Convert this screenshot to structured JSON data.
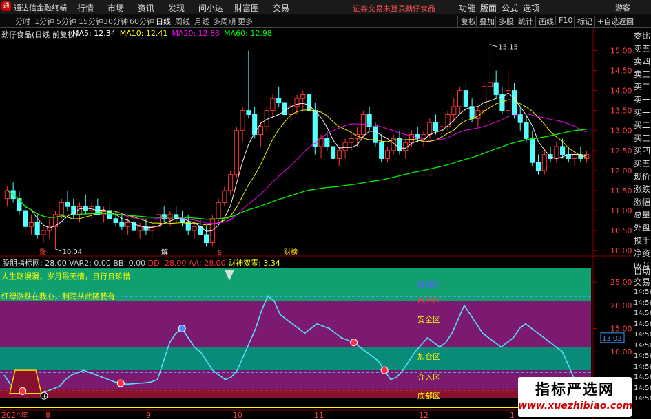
{
  "app": {
    "title": "通达信金融终端",
    "logo": "logo-icon",
    "guest": "游客"
  },
  "menu": [
    "行情",
    "市场",
    "资讯",
    "发现",
    "问小达",
    "财富圈",
    "交易"
  ],
  "notice": "证券交易未登录",
  "notice_stock": "劲仔食品",
  "right_menu": [
    "功能",
    "版面",
    "公式",
    "选项"
  ],
  "toolbar": {
    "periods": [
      "分时",
      "1分钟",
      "5分钟",
      "15分钟",
      "30分钟",
      "60分钟",
      "日线",
      "周线",
      "月线",
      "多周期",
      "更多"
    ],
    "active": "日线",
    "right": [
      "复权",
      "叠加",
      "多股",
      "统计",
      "画线",
      "F10",
      "标记",
      "+自选",
      "返回"
    ]
  },
  "price_panel": {
    "stock": "劲仔食品(日线 前复权)",
    "ma_labels": [
      {
        "text": "MA5: 12.34",
        "color": "#ffffff"
      },
      {
        "text": "MA10: 12.41",
        "color": "#ffff00"
      },
      {
        "text": "MA20: 12.83",
        "color": "#ff00ff"
      },
      {
        "text": "MA60: 12.98",
        "color": "#00ff00"
      }
    ],
    "high_label": "15.15",
    "low_label": "10.04",
    "events": [
      "涨",
      "解",
      "$",
      "财榜"
    ]
  },
  "indicator_panel": {
    "name": "股朋指标网",
    "values": [
      {
        "text": "VAR2: 0.00",
        "color": "#cccccc"
      },
      {
        "text": "BB: 0.00",
        "color": "#cccccc"
      },
      {
        "text": "DD: 28.00",
        "color": "#ff3030"
      },
      {
        "text": "AA: 28.00",
        "color": "#ff3030"
      },
      {
        "text": "财神双零: 3.34",
        "color": "#ffff00"
      }
    ],
    "first_value": ": 28.00",
    "slogan1": "人生路漫漫，岁月最无情，且行且珍惜",
    "slogan2": "红绿涨跌在我心，利润从此随我有",
    "zones": [
      "逃顶区",
      "风险区",
      "安全区",
      "加仓区",
      "介入区",
      "底部区"
    ],
    "current_value": "13.02"
  },
  "right_panel": [
    "委比",
    "卖五",
    "卖四",
    "卖三",
    "卖二",
    "卖一",
    "买一",
    "买二",
    "买三",
    "买四",
    "买五",
    "现价",
    "涨跌",
    "涨幅",
    "总量",
    "外盘",
    "换手",
    "净资",
    "收益"
  ],
  "right_panel2": [
    "自动",
    "交易",
    "14:56",
    "14:56",
    "14:56",
    "14:56",
    "14:56",
    "14:56",
    "14:56",
    "14:56",
    "14:56",
    "14:56",
    "14:56"
  ],
  "watermark": {
    "l1": "指标严选网",
    "l2": "www.xuezhibiao.com"
  },
  "chart_data": [
    {
      "type": "candlestick",
      "title": "劲仔食品(日线 前复权)",
      "y_ticks": [
        15.0,
        14.5,
        14.0,
        13.5,
        13.0,
        12.5,
        12.0,
        11.5,
        11.0,
        10.5,
        10.0
      ],
      "ylim": [
        9.9,
        15.3
      ],
      "x_labels": [
        "2024年",
        "8",
        "9",
        "10",
        "11",
        "12",
        "1"
      ],
      "candles": [
        [
          11.3,
          11.6,
          11.1,
          11.5
        ],
        [
          11.5,
          11.7,
          11.2,
          11.3
        ],
        [
          11.3,
          11.5,
          10.9,
          11.0
        ],
        [
          11.0,
          11.2,
          10.5,
          10.6
        ],
        [
          10.6,
          10.9,
          10.4,
          10.7
        ],
        [
          10.7,
          10.9,
          10.3,
          10.4
        ],
        [
          10.4,
          10.6,
          10.2,
          10.5
        ],
        [
          10.5,
          10.8,
          10.3,
          10.6
        ],
        [
          10.6,
          11.0,
          10.04,
          10.9
        ],
        [
          10.9,
          11.3,
          10.8,
          11.2
        ],
        [
          11.2,
          11.5,
          11.0,
          11.1
        ],
        [
          11.1,
          11.3,
          10.8,
          10.9
        ],
        [
          10.9,
          11.2,
          10.7,
          11.1
        ],
        [
          11.1,
          11.4,
          10.9,
          11.0
        ],
        [
          11.0,
          11.2,
          10.8,
          11.1
        ],
        [
          11.1,
          11.3,
          10.9,
          10.9
        ],
        [
          10.9,
          11.1,
          10.7,
          11.0
        ],
        [
          11.0,
          11.2,
          10.8,
          10.8
        ],
        [
          10.8,
          11.0,
          10.6,
          10.7
        ],
        [
          10.7,
          10.9,
          10.5,
          10.6
        ],
        [
          10.6,
          10.8,
          10.4,
          10.7
        ],
        [
          10.7,
          10.9,
          10.5,
          10.5
        ],
        [
          10.5,
          10.7,
          10.3,
          10.6
        ],
        [
          10.6,
          10.8,
          10.4,
          10.5
        ],
        [
          10.5,
          10.7,
          10.3,
          10.6
        ],
        [
          10.6,
          11.0,
          10.5,
          10.9
        ],
        [
          10.9,
          11.1,
          10.7,
          10.8
        ],
        [
          10.8,
          11.0,
          10.6,
          10.9
        ],
        [
          10.9,
          11.1,
          10.7,
          10.8
        ],
        [
          10.8,
          11.0,
          10.6,
          10.7
        ],
        [
          10.7,
          10.9,
          10.4,
          10.5
        ],
        [
          10.5,
          10.7,
          10.3,
          10.6
        ],
        [
          10.6,
          10.8,
          10.4,
          10.4
        ],
        [
          10.4,
          10.6,
          10.1,
          10.2
        ],
        [
          10.2,
          10.9,
          10.1,
          10.8
        ],
        [
          10.8,
          11.3,
          10.7,
          11.2
        ],
        [
          11.2,
          11.6,
          11.1,
          11.5
        ],
        [
          11.5,
          12.0,
          11.4,
          11.9
        ],
        [
          11.9,
          13.1,
          11.8,
          13.0
        ],
        [
          13.0,
          13.6,
          12.7,
          13.5
        ],
        [
          13.5,
          15.0,
          13.3,
          13.4
        ],
        [
          13.4,
          13.6,
          12.8,
          12.9
        ],
        [
          12.9,
          13.2,
          12.6,
          13.1
        ],
        [
          13.1,
          13.6,
          13.0,
          13.5
        ],
        [
          13.5,
          13.9,
          13.3,
          13.8
        ],
        [
          13.8,
          14.1,
          13.6,
          13.7
        ],
        [
          13.7,
          13.9,
          13.3,
          13.4
        ],
        [
          13.4,
          13.7,
          13.2,
          13.6
        ],
        [
          13.6,
          13.9,
          13.4,
          13.8
        ],
        [
          13.8,
          14.0,
          13.5,
          13.9
        ],
        [
          13.9,
          14.0,
          13.4,
          13.5
        ],
        [
          13.5,
          13.7,
          12.4,
          12.6
        ],
        [
          12.6,
          12.9,
          12.3,
          12.8
        ],
        [
          12.8,
          13.0,
          12.5,
          12.6
        ],
        [
          12.6,
          12.8,
          12.2,
          12.3
        ],
        [
          12.3,
          12.6,
          12.1,
          12.5
        ],
        [
          12.5,
          12.8,
          12.3,
          12.7
        ],
        [
          12.7,
          13.0,
          12.5,
          12.8
        ],
        [
          12.8,
          13.1,
          12.6,
          12.9
        ],
        [
          12.9,
          13.5,
          12.8,
          13.4
        ],
        [
          13.4,
          13.6,
          13.0,
          13.1
        ],
        [
          13.1,
          13.2,
          12.6,
          12.7
        ],
        [
          12.7,
          12.9,
          12.2,
          12.3
        ],
        [
          12.3,
          12.6,
          12.2,
          12.5
        ],
        [
          12.5,
          12.9,
          12.4,
          12.8
        ],
        [
          12.8,
          13.0,
          12.4,
          12.5
        ],
        [
          12.5,
          12.8,
          12.3,
          12.7
        ],
        [
          12.7,
          13.0,
          12.6,
          12.9
        ],
        [
          12.9,
          13.1,
          12.7,
          12.8
        ],
        [
          12.8,
          13.0,
          12.6,
          12.9
        ],
        [
          12.9,
          13.3,
          12.8,
          13.2
        ],
        [
          13.2,
          13.4,
          12.9,
          13.0
        ],
        [
          13.0,
          13.2,
          12.8,
          13.1
        ],
        [
          13.1,
          13.5,
          13.0,
          13.4
        ],
        [
          13.4,
          13.8,
          13.2,
          13.6
        ],
        [
          13.6,
          14.1,
          13.4,
          14.0
        ],
        [
          14.0,
          14.2,
          13.5,
          13.6
        ],
        [
          13.6,
          13.8,
          13.2,
          13.3
        ],
        [
          13.3,
          13.6,
          13.1,
          13.5
        ],
        [
          13.5,
          14.2,
          13.4,
          14.1
        ],
        [
          14.1,
          15.15,
          13.9,
          14.2
        ],
        [
          14.2,
          14.5,
          13.8,
          13.9
        ],
        [
          13.9,
          14.1,
          13.4,
          13.5
        ],
        [
          13.5,
          14.5,
          13.4,
          14.0
        ],
        [
          14.0,
          14.2,
          13.3,
          13.4
        ],
        [
          13.4,
          13.6,
          13.0,
          13.2
        ],
        [
          13.2,
          13.4,
          12.7,
          12.8
        ],
        [
          12.8,
          13.0,
          12.1,
          12.2
        ],
        [
          12.2,
          12.4,
          11.9,
          12.0
        ],
        [
          12.0,
          12.5,
          11.9,
          12.4
        ],
        [
          12.4,
          12.6,
          12.2,
          12.3
        ],
        [
          12.3,
          12.7,
          12.2,
          12.6
        ],
        [
          12.6,
          12.8,
          12.3,
          12.4
        ],
        [
          12.4,
          12.6,
          12.2,
          12.3
        ],
        [
          12.3,
          12.5,
          12.1,
          12.4
        ],
        [
          12.4,
          12.6,
          12.2,
          12.3
        ],
        [
          12.3,
          12.5,
          12.2,
          12.4
        ]
      ],
      "series": [
        {
          "name": "MA5",
          "color": "#ffffff"
        },
        {
          "name": "MA10",
          "color": "#ffff00"
        },
        {
          "name": "MA20",
          "color": "#ff00ff"
        },
        {
          "name": "MA60",
          "color": "#00ff00"
        }
      ]
    },
    {
      "type": "line",
      "title": "股朋指标网",
      "y_ticks": [
        25.0,
        20.0,
        15.0,
        10.0
      ],
      "ylim": [
        -2,
        28
      ],
      "bands": [
        {
          "name": "逃顶区",
          "from": 21,
          "to": 28,
          "color": "#10a070"
        },
        {
          "name": "风险区",
          "from": 11,
          "to": 21,
          "color": "#7b1a6e"
        },
        {
          "name": "安全区",
          "from": 11,
          "to": 21,
          "color": "#7b1a6e"
        },
        {
          "name": "加仓区",
          "from": 6,
          "to": 11,
          "color": "#0a8a78"
        },
        {
          "name": "介入区",
          "from": 2,
          "to": 6,
          "color": "#7b1a6e"
        },
        {
          "name": "底部区",
          "from": 0,
          "to": 2,
          "color": "#8a1030"
        }
      ],
      "values": [
        5,
        3,
        2,
        1.5,
        1,
        1,
        1,
        1.5,
        2,
        2.5,
        4,
        5,
        5.5,
        6,
        5.5,
        5,
        4.5,
        4,
        3.5,
        3.2,
        3,
        3.1,
        3.2,
        3.3,
        3.5,
        4,
        8,
        12,
        14,
        15,
        13,
        11,
        10,
        8,
        6,
        5,
        4,
        4.5,
        6,
        9,
        12,
        15,
        19,
        22,
        21,
        18,
        17,
        16,
        15,
        14,
        15,
        16,
        15.5,
        15,
        14,
        13,
        12.5,
        12,
        11,
        10,
        9,
        8,
        6,
        4,
        4.5,
        6,
        8,
        10,
        11.5,
        13,
        12,
        11,
        12,
        14,
        17,
        20,
        18,
        16,
        14,
        13,
        12,
        11,
        12,
        13,
        15,
        16,
        15,
        14,
        13,
        12,
        11,
        10,
        7,
        4,
        2,
        1
      ],
      "markers": [
        3,
        19,
        29,
        57,
        62
      ]
    }
  ]
}
